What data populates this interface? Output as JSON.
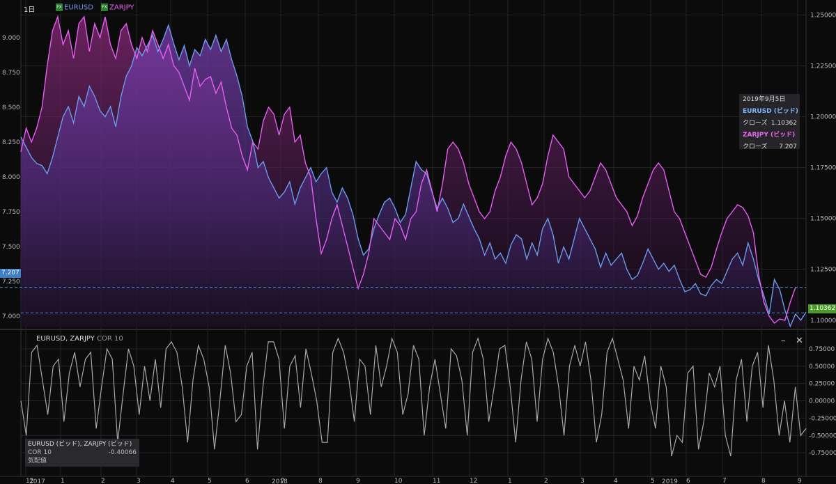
{
  "header": {
    "interval": "1日",
    "symbol1": "EURUSD",
    "symbol2": "ZARJPY",
    "fx_icon": "FX"
  },
  "tooltip": {
    "date": "2019年9月5日",
    "s1_title": "EURUSD (ビッド)",
    "s1_label": "クローズ",
    "s1_value": "1.10362",
    "s2_title": "ZARJPY (ビッド)",
    "s2_label": "クローズ",
    "s2_value": "7.207"
  },
  "badges": {
    "zarjpy_price": "7.207",
    "eurusd_price": "1.10362"
  },
  "indicator": {
    "title": "EURUSD, ZARJPY",
    "name": "COR 10",
    "minimize": "–",
    "close": "✕",
    "legend_title": "EURUSD (ビッド), ZARJPY (ビッド)",
    "legend_label": "COR 10",
    "legend_value": "-0.40066",
    "legend_extra": "気配値"
  },
  "colors": {
    "eurusd": "#6b9bea",
    "zarjpy": "#e55ff0",
    "correlation": "#a9a9a9",
    "tooltip_eurusd": "#7fb4ff",
    "tooltip_zarjpy": "#ef66ef",
    "price_badge_blue": "#3d7ec7",
    "price_badge_green": "#4a9a2a"
  },
  "chart_data": [
    {
      "type": "area",
      "series": [
        {
          "name": "EURUSD",
          "axis": "right",
          "values": [
            1.19,
            1.185,
            1.18,
            1.177,
            1.176,
            1.172,
            1.18,
            1.19,
            1.2,
            1.205,
            1.197,
            1.21,
            1.205,
            1.215,
            1.21,
            1.203,
            1.2,
            1.205,
            1.195,
            1.21,
            1.22,
            1.225,
            1.234,
            1.23,
            1.235,
            1.24,
            1.232,
            1.238,
            1.245,
            1.236,
            1.228,
            1.235,
            1.225,
            1.233,
            1.23,
            1.238,
            1.233,
            1.24,
            1.232,
            1.238,
            1.228,
            1.22,
            1.21,
            1.195,
            1.188,
            1.175,
            1.178,
            1.17,
            1.165,
            1.16,
            1.163,
            1.168,
            1.157,
            1.165,
            1.17,
            1.175,
            1.168,
            1.172,
            1.175,
            1.163,
            1.158,
            1.165,
            1.16,
            1.152,
            1.14,
            1.132,
            1.135,
            1.145,
            1.152,
            1.158,
            1.16,
            1.155,
            1.148,
            1.152,
            1.165,
            1.178,
            1.174,
            1.172,
            1.163,
            1.155,
            1.16,
            1.155,
            1.148,
            1.15,
            1.157,
            1.151,
            1.145,
            1.14,
            1.132,
            1.138,
            1.13,
            1.133,
            1.128,
            1.137,
            1.142,
            1.14,
            1.13,
            1.138,
            1.132,
            1.145,
            1.15,
            1.142,
            1.128,
            1.136,
            1.13,
            1.14,
            1.15,
            1.145,
            1.14,
            1.135,
            1.126,
            1.133,
            1.127,
            1.13,
            1.133,
            1.125,
            1.12,
            1.122,
            1.128,
            1.135,
            1.13,
            1.125,
            1.128,
            1.124,
            1.127,
            1.12,
            1.114,
            1.115,
            1.118,
            1.113,
            1.112,
            1.117,
            1.12,
            1.118,
            1.124,
            1.13,
            1.133,
            1.127,
            1.138,
            1.13,
            1.12,
            1.112,
            1.103,
            1.12,
            1.115,
            1.105,
            1.097,
            1.103,
            1.1,
            1.104
          ]
        },
        {
          "name": "ZARJPY",
          "axis": "left",
          "values": [
            8.18,
            8.35,
            8.25,
            8.35,
            8.5,
            8.8,
            9.05,
            9.15,
            8.95,
            9.05,
            8.85,
            9.1,
            9.15,
            8.9,
            9.1,
            9.0,
            9.15,
            8.95,
            8.85,
            9.05,
            9.1,
            8.95,
            8.85,
            9.0,
            8.9,
            9.05,
            8.95,
            8.85,
            8.95,
            8.8,
            8.75,
            8.65,
            8.55,
            8.78,
            8.65,
            8.7,
            8.72,
            8.6,
            8.68,
            8.5,
            8.35,
            8.3,
            8.15,
            8.05,
            8.25,
            8.2,
            8.4,
            8.5,
            8.45,
            8.3,
            8.45,
            8.5,
            8.25,
            8.3,
            8.1,
            8.0,
            7.7,
            7.45,
            7.55,
            7.7,
            7.8,
            7.65,
            7.5,
            7.35,
            7.2,
            7.3,
            7.45,
            7.7,
            7.65,
            7.6,
            7.55,
            7.7,
            7.65,
            7.55,
            7.7,
            7.75,
            7.95,
            8.05,
            7.9,
            7.75,
            7.95,
            8.2,
            8.25,
            8.2,
            8.1,
            7.95,
            7.85,
            7.75,
            7.7,
            7.75,
            7.9,
            8.0,
            8.15,
            8.25,
            8.2,
            8.1,
            7.95,
            7.8,
            7.85,
            7.95,
            8.15,
            8.3,
            8.25,
            8.2,
            8.0,
            7.95,
            7.9,
            7.85,
            7.9,
            8.0,
            8.1,
            8.05,
            7.95,
            7.85,
            7.8,
            7.75,
            7.65,
            7.72,
            7.85,
            7.95,
            8.05,
            8.1,
            8.05,
            7.9,
            7.75,
            7.7,
            7.6,
            7.5,
            7.4,
            7.3,
            7.28,
            7.35,
            7.48,
            7.6,
            7.7,
            7.75,
            7.8,
            7.78,
            7.72,
            7.6,
            7.3,
            7.1,
            7.0,
            6.95,
            6.98,
            6.97,
            7.1,
            7.207
          ]
        }
      ],
      "y_left": {
        "ticks": [
          "9.000",
          "8.750",
          "8.500",
          "8.250",
          "8.000",
          "7.750",
          "7.500",
          "7.250",
          "7.000"
        ],
        "range": [
          6.92,
          9.25
        ]
      },
      "y_right": {
        "ticks": [
          "1.25000",
          "1.22500",
          "1.20000",
          "1.17500",
          "1.15000",
          "1.12500",
          "1.10000"
        ],
        "range": [
          1.0965,
          1.256
        ]
      }
    },
    {
      "type": "line",
      "series": [
        {
          "name": "COR 10",
          "values": [
            0.0,
            -0.5,
            0.7,
            0.8,
            0.3,
            -0.2,
            0.5,
            0.6,
            -0.3,
            0.4,
            0.7,
            0.2,
            0.6,
            0.7,
            -0.4,
            0.2,
            0.75,
            0.6,
            -0.6,
            0.1,
            0.75,
            0.5,
            -0.2,
            0.5,
            0.0,
            0.6,
            -0.1,
            0.75,
            0.85,
            0.7,
            0.2,
            -0.6,
            0.3,
            0.8,
            0.6,
            0.2,
            -0.7,
            0.0,
            0.8,
            0.4,
            -0.3,
            -0.2,
            0.5,
            0.7,
            -0.7,
            0.2,
            0.85,
            0.85,
            0.6,
            -0.4,
            0.5,
            0.65,
            -0.1,
            0.75,
            0.4,
            0.0,
            -0.6,
            -0.6,
            0.7,
            0.9,
            0.7,
            0.3,
            -0.3,
            0.6,
            0.5,
            -0.2,
            0.8,
            0.2,
            0.5,
            0.9,
            0.7,
            -0.2,
            0.1,
            0.8,
            0.6,
            -0.5,
            0.2,
            0.6,
            0.1,
            -0.4,
            0.75,
            0.65,
            0.3,
            -0.5,
            0.7,
            0.9,
            0.6,
            -0.3,
            0.2,
            0.75,
            0.8,
            0.2,
            -0.6,
            0.3,
            0.85,
            0.6,
            -0.3,
            0.6,
            0.9,
            0.7,
            0.2,
            -0.5,
            0.5,
            0.8,
            0.5,
            0.85,
            0.3,
            -0.6,
            -0.2,
            0.7,
            0.9,
            0.6,
            0.3,
            -0.4,
            0.5,
            0.3,
            0.65,
            0.0,
            -0.4,
            0.5,
            0.2,
            -0.8,
            -0.5,
            -0.6,
            0.4,
            0.5,
            -0.7,
            -0.3,
            0.4,
            0.2,
            0.5,
            -0.5,
            -0.8,
            0.3,
            0.6,
            -0.3,
            0.5,
            0.7,
            -0.1,
            0.8,
            0.3,
            -0.5,
            0.0,
            -0.6,
            0.2,
            -0.5,
            -0.4
          ]
        }
      ],
      "y": {
        "ticks": [
          "0.75000",
          "0.50000",
          "0.25000",
          "0.00000",
          "-0.25000",
          "-0.50000",
          "-0.75000"
        ],
        "range": [
          -1.05,
          1.0
        ]
      }
    }
  ],
  "x_axis": {
    "ticks": [
      "12",
      "1",
      "2",
      "3",
      "4",
      "5",
      "6",
      "7",
      "8",
      "9",
      "10",
      "11",
      "12",
      "1",
      "2",
      "3",
      "4",
      "5",
      "6",
      "7",
      "8",
      "9"
    ],
    "years": [
      "2017",
      "2018",
      "2019"
    ]
  }
}
